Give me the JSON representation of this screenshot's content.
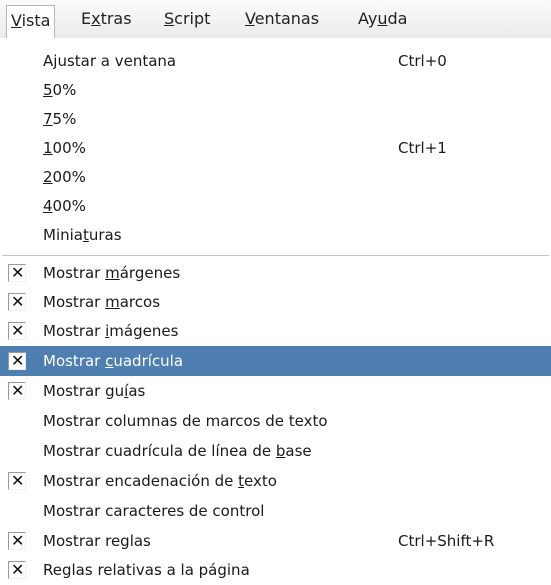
{
  "menubar": {
    "items": [
      {
        "pre": "",
        "ul": "V",
        "post": "ista"
      },
      {
        "pre": "E",
        "ul": "x",
        "post": "tras"
      },
      {
        "pre": "",
        "ul": "S",
        "post": "cript"
      },
      {
        "pre": "",
        "ul": "V",
        "post": "entanas"
      },
      {
        "pre": "Ay",
        "ul": "u",
        "post": "da"
      }
    ]
  },
  "view_menu": {
    "zoom_items": [
      {
        "pre": "A",
        "ul": "j",
        "post": "ustar a ventana",
        "shortcut": "Ctrl+0"
      },
      {
        "pre": "",
        "ul": "5",
        "post": "0%",
        "shortcut": ""
      },
      {
        "pre": "",
        "ul": "7",
        "post": "5%",
        "shortcut": ""
      },
      {
        "pre": "",
        "ul": "1",
        "post": "00%",
        "shortcut": "Ctrl+1"
      },
      {
        "pre": "",
        "ul": "2",
        "post": "00%",
        "shortcut": ""
      },
      {
        "pre": "",
        "ul": "4",
        "post": "00%",
        "shortcut": ""
      },
      {
        "pre": "Minia",
        "ul": "t",
        "post": "uras",
        "shortcut": ""
      }
    ],
    "show_items": [
      {
        "pre": "Mostrar ",
        "ul": "m",
        "post": "árgenes",
        "checked": true,
        "highlighted": false,
        "shortcut": ""
      },
      {
        "pre": "Mostrar ",
        "ul": "m",
        "post": "arcos",
        "checked": true,
        "highlighted": false,
        "shortcut": ""
      },
      {
        "pre": "Mostrar ",
        "ul": "i",
        "post": "mágenes",
        "checked": true,
        "highlighted": false,
        "shortcut": ""
      },
      {
        "pre": "Mostrar ",
        "ul": "c",
        "post": "uadrícula",
        "checked": true,
        "highlighted": true,
        "shortcut": ""
      },
      {
        "pre": "Mostrar gu",
        "ul": "í",
        "post": "as",
        "checked": true,
        "highlighted": false,
        "shortcut": ""
      },
      {
        "pre": "Mostrar columnas de marcos de texto",
        "ul": "",
        "post": "",
        "checked": false,
        "highlighted": false,
        "shortcut": ""
      },
      {
        "pre": "Mostrar cuadrícula de línea de ",
        "ul": "b",
        "post": "ase",
        "checked": false,
        "highlighted": false,
        "shortcut": ""
      },
      {
        "pre": "Mostrar encadenación de ",
        "ul": "t",
        "post": "exto",
        "checked": true,
        "highlighted": false,
        "shortcut": ""
      },
      {
        "pre": "Mostrar caracteres de control",
        "ul": "",
        "post": "",
        "checked": false,
        "highlighted": false,
        "shortcut": ""
      },
      {
        "pre": "Mostrar reglas",
        "ul": "",
        "post": "",
        "checked": true,
        "highlighted": false,
        "shortcut": "Ctrl+Shift+R"
      },
      {
        "pre": "Reglas relativas a la página",
        "ul": "",
        "post": "",
        "checked": true,
        "highlighted": false,
        "shortcut": ""
      }
    ],
    "check_glyph": "✕"
  }
}
